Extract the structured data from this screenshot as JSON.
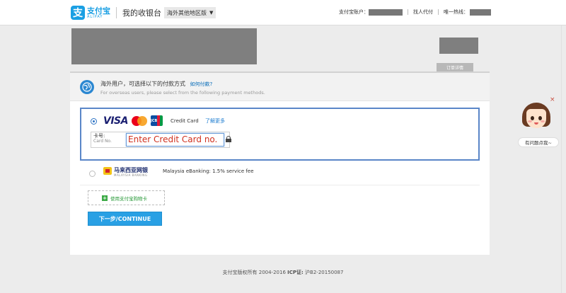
{
  "header": {
    "logo_cn": "支付宝",
    "logo_en": "ALIPAY",
    "title": "我的收银台",
    "region": "海外其他地区版",
    "account_label": "支付宝账户：",
    "pay_for_me": "找人代付",
    "hotline_label": "唯一热线："
  },
  "order": {
    "detail_label": "订单详情"
  },
  "overseas": {
    "title_cn": "海外用户，可选择以下的付款方式",
    "how_to_pay": "如何付款?",
    "subtitle_en": "For overseas users, please select from the following payment methods."
  },
  "credit_card": {
    "brand_visa": "VISA",
    "brand_jcb": "JCB",
    "label": "Credit Card",
    "learn_more": "了解更多",
    "card_no_label_cn": "卡号:",
    "card_no_label_en": "Card No.",
    "card_input_value": "Enter Credit Card no."
  },
  "malaysia": {
    "logo_cn": "马来西亚网银",
    "logo_sub": "MALAYSIA BANKING",
    "label": "Malaysia eBanking: 1.5% service fee"
  },
  "giftcard": {
    "label": "使用支付宝购物卡"
  },
  "continue_button": {
    "label": "下一步/CONTINUE"
  },
  "footer": {
    "copyright": "支付宝版权所有 2004-2016",
    "icp_label": "ICP证:",
    "icp_value": "沪B2-20150087"
  },
  "helper": {
    "bubble": "有问题点我~",
    "close": "×"
  },
  "colors": {
    "alipay_blue": "#1a9fe3",
    "continue_blue": "#29a0e4",
    "selection_border": "#5a86c8",
    "input_text_red": "#d0311f"
  }
}
